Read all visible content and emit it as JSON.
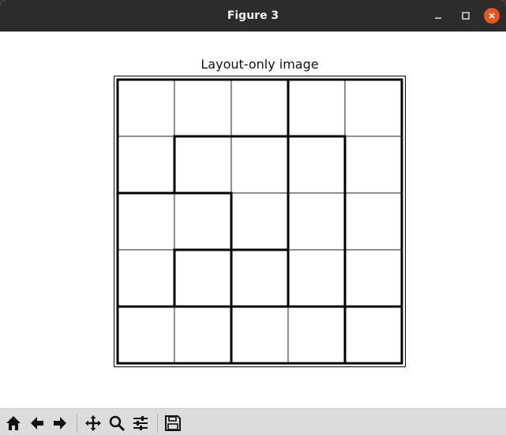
{
  "window": {
    "title": "Figure 3"
  },
  "plot": {
    "title": "Layout-only image"
  },
  "chart_data": {
    "type": "grid",
    "rows": 5,
    "cols": 5,
    "title": "Layout-only image",
    "regions": [
      [
        1,
        1,
        1,
        2,
        2
      ],
      [
        1,
        3,
        3,
        4,
        2
      ],
      [
        5,
        5,
        3,
        4,
        2
      ],
      [
        5,
        6,
        5,
        4,
        2
      ],
      [
        7,
        7,
        8,
        8,
        9
      ]
    ]
  },
  "toolbar": {
    "tools": [
      "home-icon",
      "back-arrow-icon",
      "forward-arrow-icon",
      "pan-icon",
      "zoom-icon",
      "configure-subplots-icon",
      "save-icon"
    ]
  }
}
